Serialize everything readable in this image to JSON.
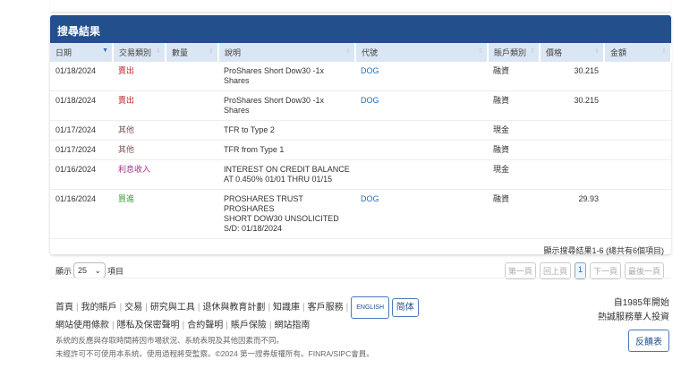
{
  "panel": {
    "title": "搜尋結果"
  },
  "columns": [
    "日期",
    "交易類別",
    "數量",
    "說明",
    "代號",
    "賬戶類別",
    "價格",
    "金額"
  ],
  "rows": [
    {
      "date": "01/18/2024",
      "type": "賣出",
      "type_kind": "sell",
      "qty": "",
      "desc": [
        "ProShares Short Dow30 -1x Shares"
      ],
      "symbol": "DOG",
      "account": "融資",
      "price": "30.215",
      "amount": ""
    },
    {
      "date": "01/18/2024",
      "type": "賣出",
      "type_kind": "sell",
      "qty": "",
      "desc": [
        "ProShares Short Dow30 -1x Shares"
      ],
      "symbol": "DOG",
      "account": "融資",
      "price": "30.215",
      "amount": ""
    },
    {
      "date": "01/17/2024",
      "type": "其他",
      "type_kind": "other",
      "qty": "",
      "desc": [
        "TFR to Type 2"
      ],
      "symbol": "",
      "account": "現金",
      "price": "",
      "amount": ""
    },
    {
      "date": "01/17/2024",
      "type": "其他",
      "type_kind": "other",
      "qty": "",
      "desc": [
        "TFR from Type 1"
      ],
      "symbol": "",
      "account": "融資",
      "price": "",
      "amount": ""
    },
    {
      "date": "01/16/2024",
      "type": "利息收入",
      "type_kind": "int",
      "qty": "",
      "desc": [
        "INTEREST ON CREDIT BALANCE",
        "AT 0.450% 01/01 THRU 01/15"
      ],
      "symbol": "",
      "account": "現金",
      "price": "",
      "amount": ""
    },
    {
      "date": "01/16/2024",
      "type": "買進",
      "type_kind": "buy",
      "qty": "",
      "desc": [
        "PROSHARES TRUST PROSHARES",
        "SHORT DOW30 UNSOLICITED",
        "S/D: 01/18/2024"
      ],
      "symbol": "DOG",
      "account": "融資",
      "price": "29.93",
      "amount": ""
    }
  ],
  "footer": {
    "info": "顯示搜尋結果1-6 (總共有6個項目)",
    "show_label": "顯示",
    "page_size": "25",
    "items_label": "項目",
    "pager": [
      "第一頁",
      "回上頁",
      "1",
      "下一頁",
      "最後一頁"
    ]
  },
  "site_footer": {
    "links1": [
      "首頁",
      "我的賬戶",
      "交易",
      "研究與工具",
      "退休與教育計劃",
      "知識庫",
      "客戶服務"
    ],
    "english": "ENGLISH",
    "simplified": "简体",
    "links2": [
      "網站使用條款",
      "隱私及保密聲明",
      "合約聲明",
      "賬戶保險",
      "網站指南"
    ],
    "disclaimer1": "系統的反應與存取時間將因市場狀況、系統表現及其他因素而不同。",
    "disclaimer2": "未經許可不可使用本系統。使用過程將受監察。©2024 第一證券版權所有。FINRA/SIPC會員。",
    "since": "自1985年開始",
    "serving": "熱誠服務華人投資",
    "feedback": "反饋表"
  }
}
